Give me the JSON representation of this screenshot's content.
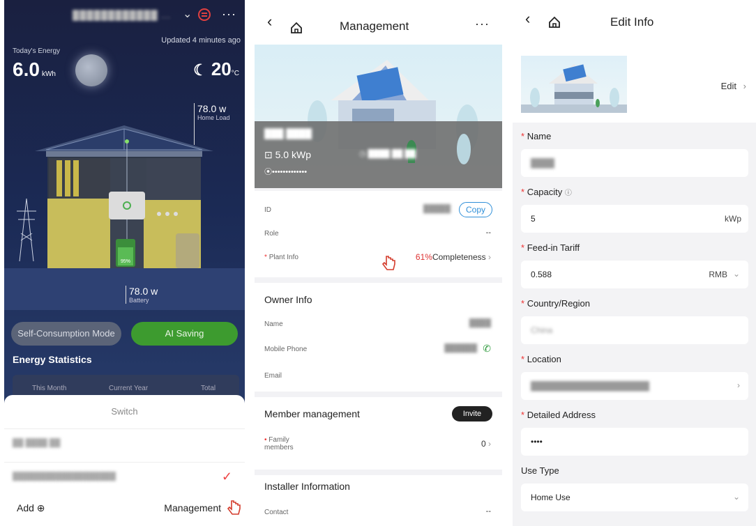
{
  "panel1": {
    "updated": "Updated 4 minutes ago",
    "todays_energy_label": "Today's Energy",
    "energy_value": "6.0",
    "energy_unit": "kWh",
    "temperature": "20",
    "temp_unit": "°C",
    "home_load_value": "78.0 w",
    "home_load_label": "Home Load",
    "battery_value": "78.0 w",
    "battery_label": "Battery",
    "battery_percent": "95%",
    "mode_self": "Self-Consumption Mode",
    "mode_ai": "AI Saving",
    "energy_statistics": "Energy Statistics",
    "tabs": [
      "This Month",
      "Current Year",
      "Total"
    ],
    "sheet": {
      "title": "Switch",
      "add": "Add ⊕",
      "management": "Management"
    }
  },
  "panel2": {
    "title": "Management",
    "capacity": "5.0 kWp",
    "id_label": "ID",
    "copy": "Copy",
    "role_label": "Role",
    "role_value": "--",
    "plant_info_label": "Plant Info",
    "completeness_pct": "61%",
    "completeness_text": "Completeness",
    "owner_info": "Owner Info",
    "name_label": "Name",
    "mobile_label": "Mobile Phone",
    "email_label": "Email",
    "member_mgmt": "Member management",
    "invite": "Invite",
    "family_label": "Family members",
    "family_value": "0",
    "installer_info": "Installer Information",
    "contact_label": "Contact",
    "contact_value": "--"
  },
  "panel3": {
    "title": "Edit Info",
    "edit": "Edit",
    "name_label": "Name",
    "capacity_label": "Capacity",
    "capacity_value": "5",
    "capacity_unit": "kWp",
    "tariff_label": "Feed-in Tariff",
    "tariff_value": "0.588",
    "tariff_currency": "RMB",
    "country_label": "Country/Region",
    "country_value": "China",
    "location_label": "Location",
    "address_label": "Detailed Address",
    "address_value": "••••",
    "use_type_label": "Use Type",
    "use_type_value": "Home Use"
  }
}
